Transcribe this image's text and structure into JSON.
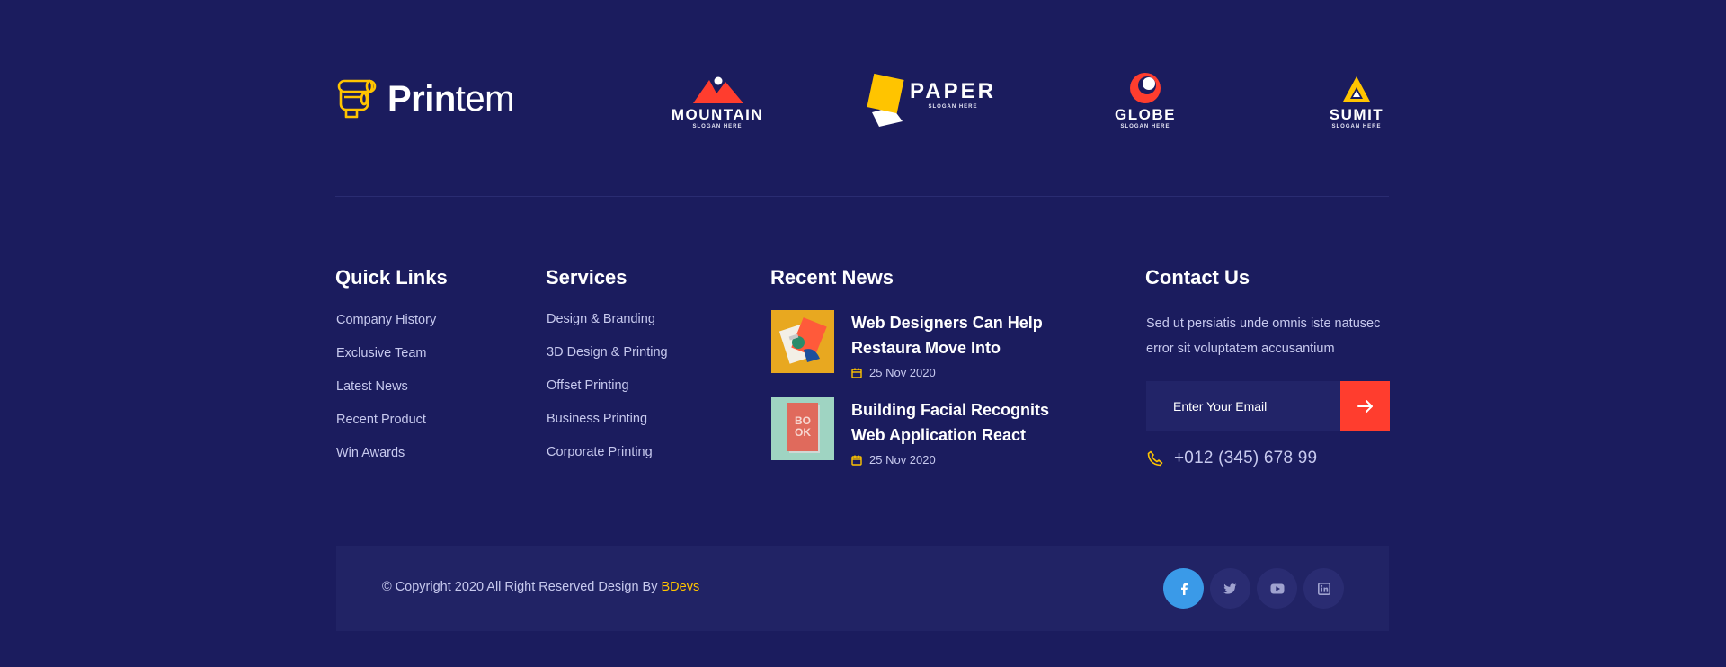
{
  "logo": {
    "strong": "Prin",
    "light": "tem"
  },
  "brands": [
    {
      "name": "MOUNTAIN",
      "slogan": "SLOGAN HERE"
    },
    {
      "name": "PAPER",
      "slogan": "SLOGAN HERE"
    },
    {
      "name": "GLOBE",
      "slogan": "SLOGAN HERE"
    },
    {
      "name": "SUMIT",
      "slogan": "SLOGAN HERE"
    }
  ],
  "quick_links": {
    "title": "Quick Links",
    "items": [
      "Company History",
      "Exclusive Team",
      "Latest News",
      "Recent Product",
      "Win Awards"
    ]
  },
  "services": {
    "title": "Services",
    "items": [
      "Design & Branding",
      "3D Design & Printing",
      "Offset Printing",
      "Business Printing",
      "Corporate Printing"
    ]
  },
  "recent_news": {
    "title": "Recent News",
    "items": [
      {
        "title": "Web Designers Can Help Restaura Move Into",
        "date": "25 Nov 2020"
      },
      {
        "title": "Building Facial Recognits Web Application React",
        "date": "25 Nov 2020"
      }
    ]
  },
  "contact": {
    "title": "Contact Us",
    "text": "Sed ut persiatis unde omnis iste natusec error sit voluptatem accusantium",
    "email_placeholder": "Enter Your Email",
    "phone": "+012 (345) 678 99"
  },
  "footer": {
    "copyright": "© Copyright 2020 All Right Reserved Design By ",
    "designer": "BDevs",
    "socials": [
      "facebook-icon",
      "twitter-icon",
      "youtube-icon",
      "linkedin-icon"
    ]
  },
  "colors": {
    "background": "#1b1c5e",
    "accent_red": "#ff3d2e",
    "accent_yellow": "#ffc400",
    "facebook_blue": "#3a9ae8"
  }
}
